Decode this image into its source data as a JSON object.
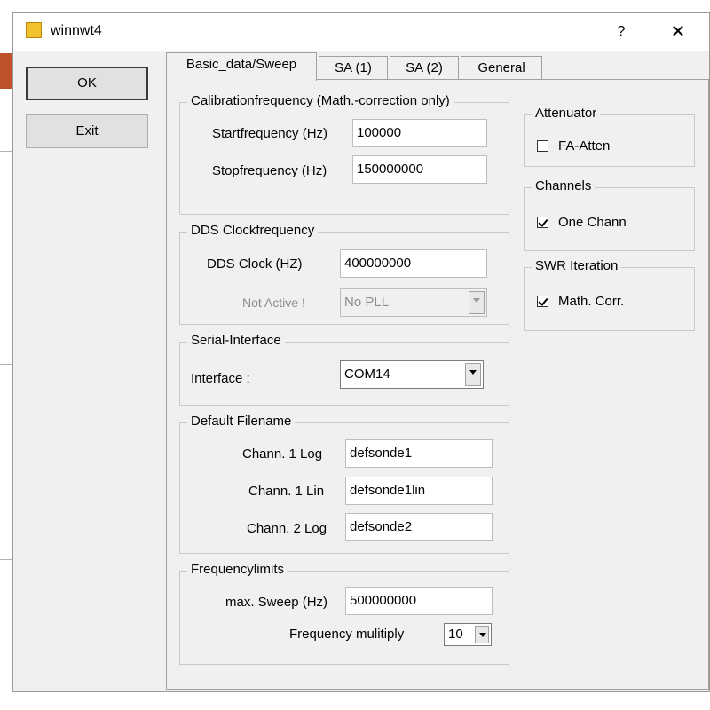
{
  "window": {
    "title": "winnwt4",
    "help_glyph": "?",
    "close_glyph": "✕"
  },
  "buttons": {
    "ok": "OK",
    "exit": "Exit"
  },
  "tabs": [
    {
      "label": "Basic_data/Sweep",
      "active": true
    },
    {
      "label": "SA (1)"
    },
    {
      "label": "SA (2)"
    },
    {
      "label": "General"
    }
  ],
  "calibration": {
    "title": "Calibrationfrequency (Math.-correction only)",
    "start_label": "Startfrequency (Hz)",
    "start_value": "100000",
    "stop_label": "Stopfrequency (Hz)",
    "stop_value": "150000000"
  },
  "dds": {
    "title": "DDS Clockfrequency",
    "clock_label": "DDS Clock (HZ)",
    "clock_value": "400000000",
    "pll_label": "Not Active !",
    "pll_value": "No PLL"
  },
  "serial": {
    "title": "Serial-Interface",
    "interface_label": "Interface :",
    "interface_value": "COM14"
  },
  "filenames": {
    "title": "Default Filename",
    "chan1_log_label": "Chann. 1  Log",
    "chan1_log_value": "defsonde1",
    "chan1_lin_label": "Chann. 1  Lin",
    "chan1_lin_value": "defsonde1lin",
    "chan2_log_label": "Chann. 2 Log",
    "chan2_log_value": "defsonde2"
  },
  "limits": {
    "title": "Frequencylimits",
    "max_sweep_label": "max. Sweep (Hz)",
    "max_sweep_value": "500000000",
    "multiply_label": "Frequency mulitiply",
    "multiply_value": "10"
  },
  "attenuator": {
    "title": "Attenuator",
    "fa_atten_label": "FA-Atten",
    "fa_atten_checked": false
  },
  "channels": {
    "title": "Channels",
    "one_chann_label": "One Chann",
    "one_chann_checked": true
  },
  "swr": {
    "title": "SWR Iteration",
    "math_corr_label": "Math. Corr.",
    "math_corr_checked": true
  },
  "colors": {
    "app_icon": "#f2c12e",
    "dialog_bg": "#f0f0f0"
  }
}
